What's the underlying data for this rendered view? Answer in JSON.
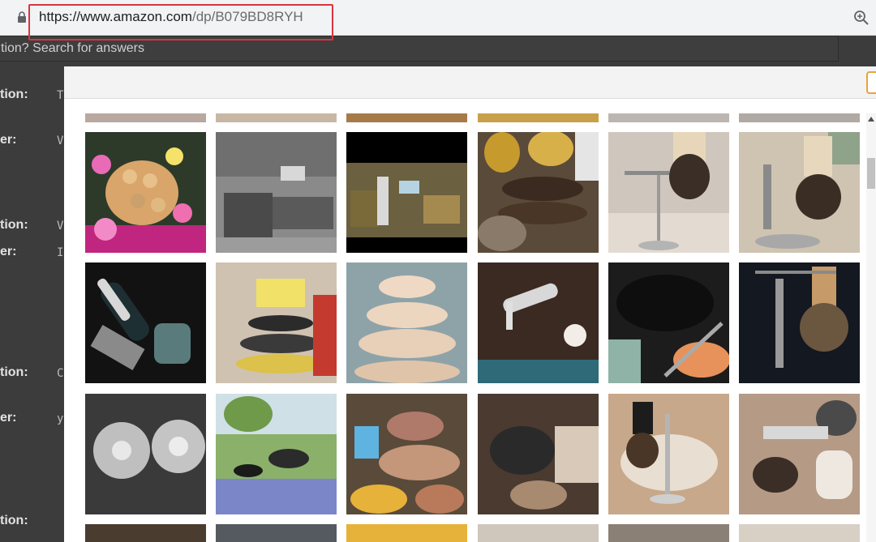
{
  "browser": {
    "url_domain": "https://www.amazon.com",
    "url_path": "/dp/B079BD8RYH"
  },
  "background_page": {
    "search_text": "tion? Search for answers",
    "labels": [
      "tion:",
      "er:",
      "tion:",
      "er:",
      "tion:",
      "er:",
      "tion:"
    ],
    "fragments": [
      "T",
      "V",
      "V",
      "I",
      "C",
      "y"
    ]
  },
  "gallery": {
    "rows": [
      [
        {
          "name": "thumb-donut-tower"
        },
        {
          "name": "thumb-living-room-bw"
        },
        {
          "name": "thumb-video-room"
        },
        {
          "name": "thumb-gold-balloons-cupcakes"
        },
        {
          "name": "thumb-shaving-stand-brush"
        },
        {
          "name": "thumb-razor-brush-stand"
        }
      ],
      [
        {
          "name": "thumb-razor-handle-dark"
        },
        {
          "name": "thumb-yellow-cake-tower"
        },
        {
          "name": "thumb-cupcake-stand"
        },
        {
          "name": "thumb-razor-on-table"
        },
        {
          "name": "thumb-black-cat"
        },
        {
          "name": "thumb-badger-brush-stand"
        }
      ],
      [
        {
          "name": "thumb-clear-discs"
        },
        {
          "name": "thumb-outdoor-party-table"
        },
        {
          "name": "thumb-cupcake-party"
        },
        {
          "name": "thumb-cat-on-chair"
        },
        {
          "name": "thumb-brush-on-sink"
        },
        {
          "name": "thumb-sink-shaving-set"
        }
      ]
    ]
  }
}
